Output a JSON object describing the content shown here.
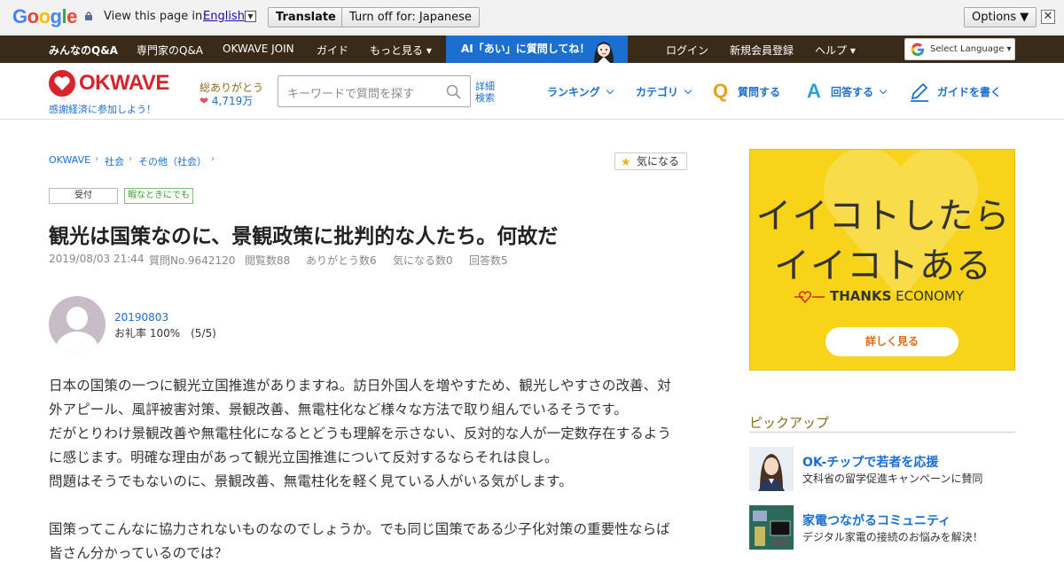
{
  "google_bar": {
    "view_text": "View this page in:",
    "language": "English",
    "translate_label": "Translate",
    "turn_off_label": "Turn off for: Japanese",
    "options_label": "Options ▼",
    "close_label": "✕"
  },
  "topnav": {
    "items": [
      "みんなのQ&A",
      "専門家のQ&A",
      "OKWAVE JOIN",
      "ガイド",
      "もっと見る ▾"
    ],
    "ai_banner": "AI「あい」に質問してね！",
    "right_items": [
      "ログイン",
      "新規会員登録",
      "ヘルプ ▾"
    ],
    "select_language": "Select Language ▾"
  },
  "header": {
    "logo_text": "OKWAVE",
    "tagline": "感謝経済に参加しよう！",
    "thanks_label": "総ありがとう",
    "thanks_count": "4,719万",
    "search_placeholder": "キーワードで質問を探す",
    "advanced_search_1": "詳細",
    "advanced_search_2": "検索",
    "nav": {
      "ranking": "ランキング",
      "category": "カテゴリ",
      "ask": "質問する",
      "answer": "回答する",
      "guide": "ガイドを書く"
    }
  },
  "breadcrumb": [
    "OKWAVE",
    "社会",
    "その他（社会）"
  ],
  "watch_button": "気になる",
  "badges": {
    "status": "受付",
    "tag": "暇なときにでも"
  },
  "question": {
    "title": "観光は国策なのに、景観政策に批判的な人たち。何故だ",
    "meta": {
      "date": "2019/08/03 21:44",
      "qno": "質問No.9642120",
      "views": "閲覧数88",
      "thanks": "ありがとう数6",
      "kini": "気になる数0",
      "answers": "回答数5"
    },
    "user": {
      "name": "20190803",
      "rate": "お礼率 100%　(5/5)"
    },
    "body": [
      "日本の国策の一つに観光立国推進がありますね。訪日外国人を増やすため、観光しやすさの改善、対",
      "外アピール、風評被害対策、景観改善、無電柱化など様々な方法で取り組んでいるそうです。",
      "だがとりわけ景観改善や無電柱化になるとどうも理解を示さない、反対的な人が一定数存在するよう",
      "に感じます。明確な理由があって観光立国推進について反対するならそれは良し。",
      "問題はそうでもないのに、景観改善、無電柱化を軽く見ている人がいる気がします。",
      "国策ってこんなに協力されないものなのでしょうか。でも同じ国策である少子化対策の重要性ならば",
      "皆さん分かっているのでは？"
    ]
  },
  "ad": {
    "line1": "イイコトしたら",
    "line2": "イイコトある",
    "brand_bold": "THANKS",
    "brand_rest": " ECONOMY",
    "button": "詳しく見る"
  },
  "pickup": {
    "heading": "ピックアップ",
    "items": [
      {
        "title": "OK-チップで若者を応援",
        "sub": "文科省の留学促進キャンペーンに賛同"
      },
      {
        "title": "家電つながるコミュニティ",
        "sub": "デジタル家電の接続のお悩みを解決！"
      }
    ]
  },
  "colors": {
    "accent": "#1a6fd0",
    "brand_red": "#d8232a",
    "nav_dark": "#3a2a1a",
    "ad_yellow": "#f7d31a"
  }
}
